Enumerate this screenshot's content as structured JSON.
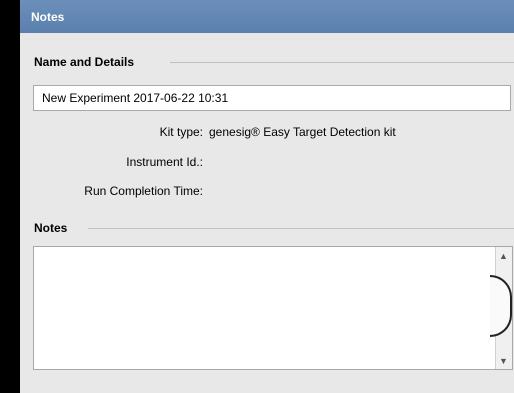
{
  "window": {
    "title": "Notes"
  },
  "name_section": {
    "heading": "Name and Details",
    "name_value": "New Experiment 2017-06-22 10:31",
    "kit_type_label": "Kit type:",
    "kit_type_value": "genesig® Easy Target Detection kit",
    "instrument_label": "Instrument Id.:",
    "instrument_value": "",
    "run_completion_label": "Run Completion Time:",
    "run_completion_value": ""
  },
  "notes_section": {
    "heading": "Notes",
    "notes_value": ""
  },
  "icons": {
    "scroll_up": "scroll-up-arrow",
    "scroll_down": "scroll-down-arrow"
  }
}
